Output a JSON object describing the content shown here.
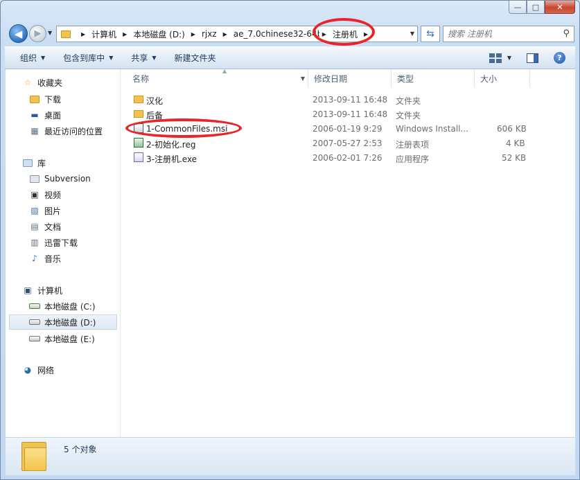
{
  "window": {
    "caption_buttons": [
      "—",
      "□",
      "✕"
    ]
  },
  "address_bar": {
    "breadcrumbs": [
      "计算机",
      "本地磁盘 (D:)",
      "rjxz",
      "ae_7.0chinese32-64bi",
      "注册机"
    ],
    "search_placeholder": "搜索 注册机"
  },
  "toolbar": {
    "organize": "组织",
    "include_in_library": "包含到库中",
    "share": "共享",
    "new_folder": "新建文件夹"
  },
  "nav_pane": {
    "favorites": {
      "label": "收藏夹",
      "items": [
        "下载",
        "桌面",
        "最近访问的位置"
      ]
    },
    "libraries": {
      "label": "库",
      "items": [
        "Subversion",
        "视频",
        "图片",
        "文档",
        "迅雷下载",
        "音乐"
      ]
    },
    "computer": {
      "label": "计算机",
      "items": [
        "本地磁盘 (C:)",
        "本地磁盘 (D:)",
        "本地磁盘 (E:)"
      ],
      "selected": "本地磁盘 (D:)"
    },
    "network": {
      "label": "网络"
    }
  },
  "columns": {
    "name": "名称",
    "modified": "修改日期",
    "type": "类型",
    "size": "大小"
  },
  "files": [
    {
      "name": "汉化",
      "modified": "2013-09-11 16:48",
      "type": "文件夹",
      "size": "",
      "icon": "folder-icon"
    },
    {
      "name": "后备",
      "modified": "2013-09-11 16:48",
      "type": "文件夹",
      "size": "",
      "icon": "folder-icon"
    },
    {
      "name": "1-CommonFiles.msi",
      "modified": "2006-01-19 9:29",
      "type": "Windows Install...",
      "size": "606 KB",
      "icon": "msi-icon"
    },
    {
      "name": "2-初始化.reg",
      "modified": "2007-05-27 2:53",
      "type": "注册表项",
      "size": "4 KB",
      "icon": "registry-icon"
    },
    {
      "name": "3-注册机.exe",
      "modified": "2006-02-01 7:26",
      "type": "应用程序",
      "size": "52 KB",
      "icon": "exe-icon"
    }
  ],
  "status_bar": {
    "count_text": "5 个对象"
  },
  "colors": {
    "annotation": "#e8252a",
    "folder": "#f2c34d",
    "selection": "#dfe8f2"
  }
}
